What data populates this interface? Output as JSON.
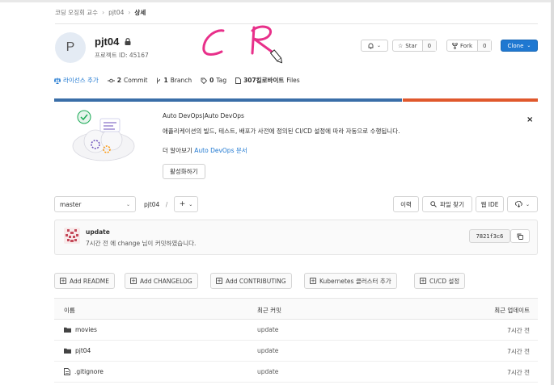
{
  "breadcrumb": [
    "코딩 오징회 교수",
    "pjt04",
    "상세"
  ],
  "project": {
    "avatar_letter": "P",
    "name": "pjt04",
    "id_text": "프로젝트 ID: 45167"
  },
  "header_buttons": {
    "notify_label": "",
    "star_label": "Star",
    "star_count": "0",
    "fork_label": "Fork",
    "fork_count": "0",
    "clone_label": "Clone"
  },
  "stats": {
    "license": "라이선스 추가",
    "commits_num": "2",
    "commits_label": "Commit",
    "branches_num": "1",
    "branches_label": "Branch",
    "tags_num": "0",
    "tags_label": "Tag",
    "files_size": "307킬로바이트",
    "files_label": "Files"
  },
  "language_bar": [
    {
      "share": 0.72,
      "color": "#3a6ea8"
    },
    {
      "share": 0.28,
      "color": "#e0582c"
    }
  ],
  "devops": {
    "title": "Auto DevOps|Auto DevOps",
    "description": "애플리케이션의 빌드, 테스트, 배포가 사전에 정의된 CI/CD 설정에 따라 자동으로 수행됩니다.",
    "more_prefix": "더 알아보기",
    "more_link": "Auto DevOps 문서",
    "activate_label": "활성화하기",
    "close": "×"
  },
  "repo_bar": {
    "branch": "master",
    "path_root": "pjt04",
    "path_sep": "/",
    "add_symbol": "+",
    "history_label": "이력",
    "find_file_label": "파일 찾기",
    "web_ide_label": "웹 IDE"
  },
  "commit": {
    "title": "update",
    "subtitle": "7시간 전 에 change 님이 커밋하였습니다.",
    "sha": "7821f3c6"
  },
  "quick_actions": [
    "Add README",
    "Add CHANGELOG",
    "Add CONTRIBUTING",
    "Kubernetes 클러스터 추가",
    "CI/CD 설정"
  ],
  "table": {
    "headers": {
      "name": "이름",
      "last_commit": "최근 커밋",
      "last_update": "최근 업데이트"
    },
    "rows": [
      {
        "name": "movies",
        "type": "folder",
        "commit": "update",
        "updated": "7시간 전"
      },
      {
        "name": "pjt04",
        "type": "folder",
        "commit": "update",
        "updated": "7시간 전"
      },
      {
        "name": ".gitignore",
        "type": "file",
        "commit": "update",
        "updated": "7시간 전"
      }
    ]
  },
  "annotation": {
    "color": "#e8308a"
  }
}
